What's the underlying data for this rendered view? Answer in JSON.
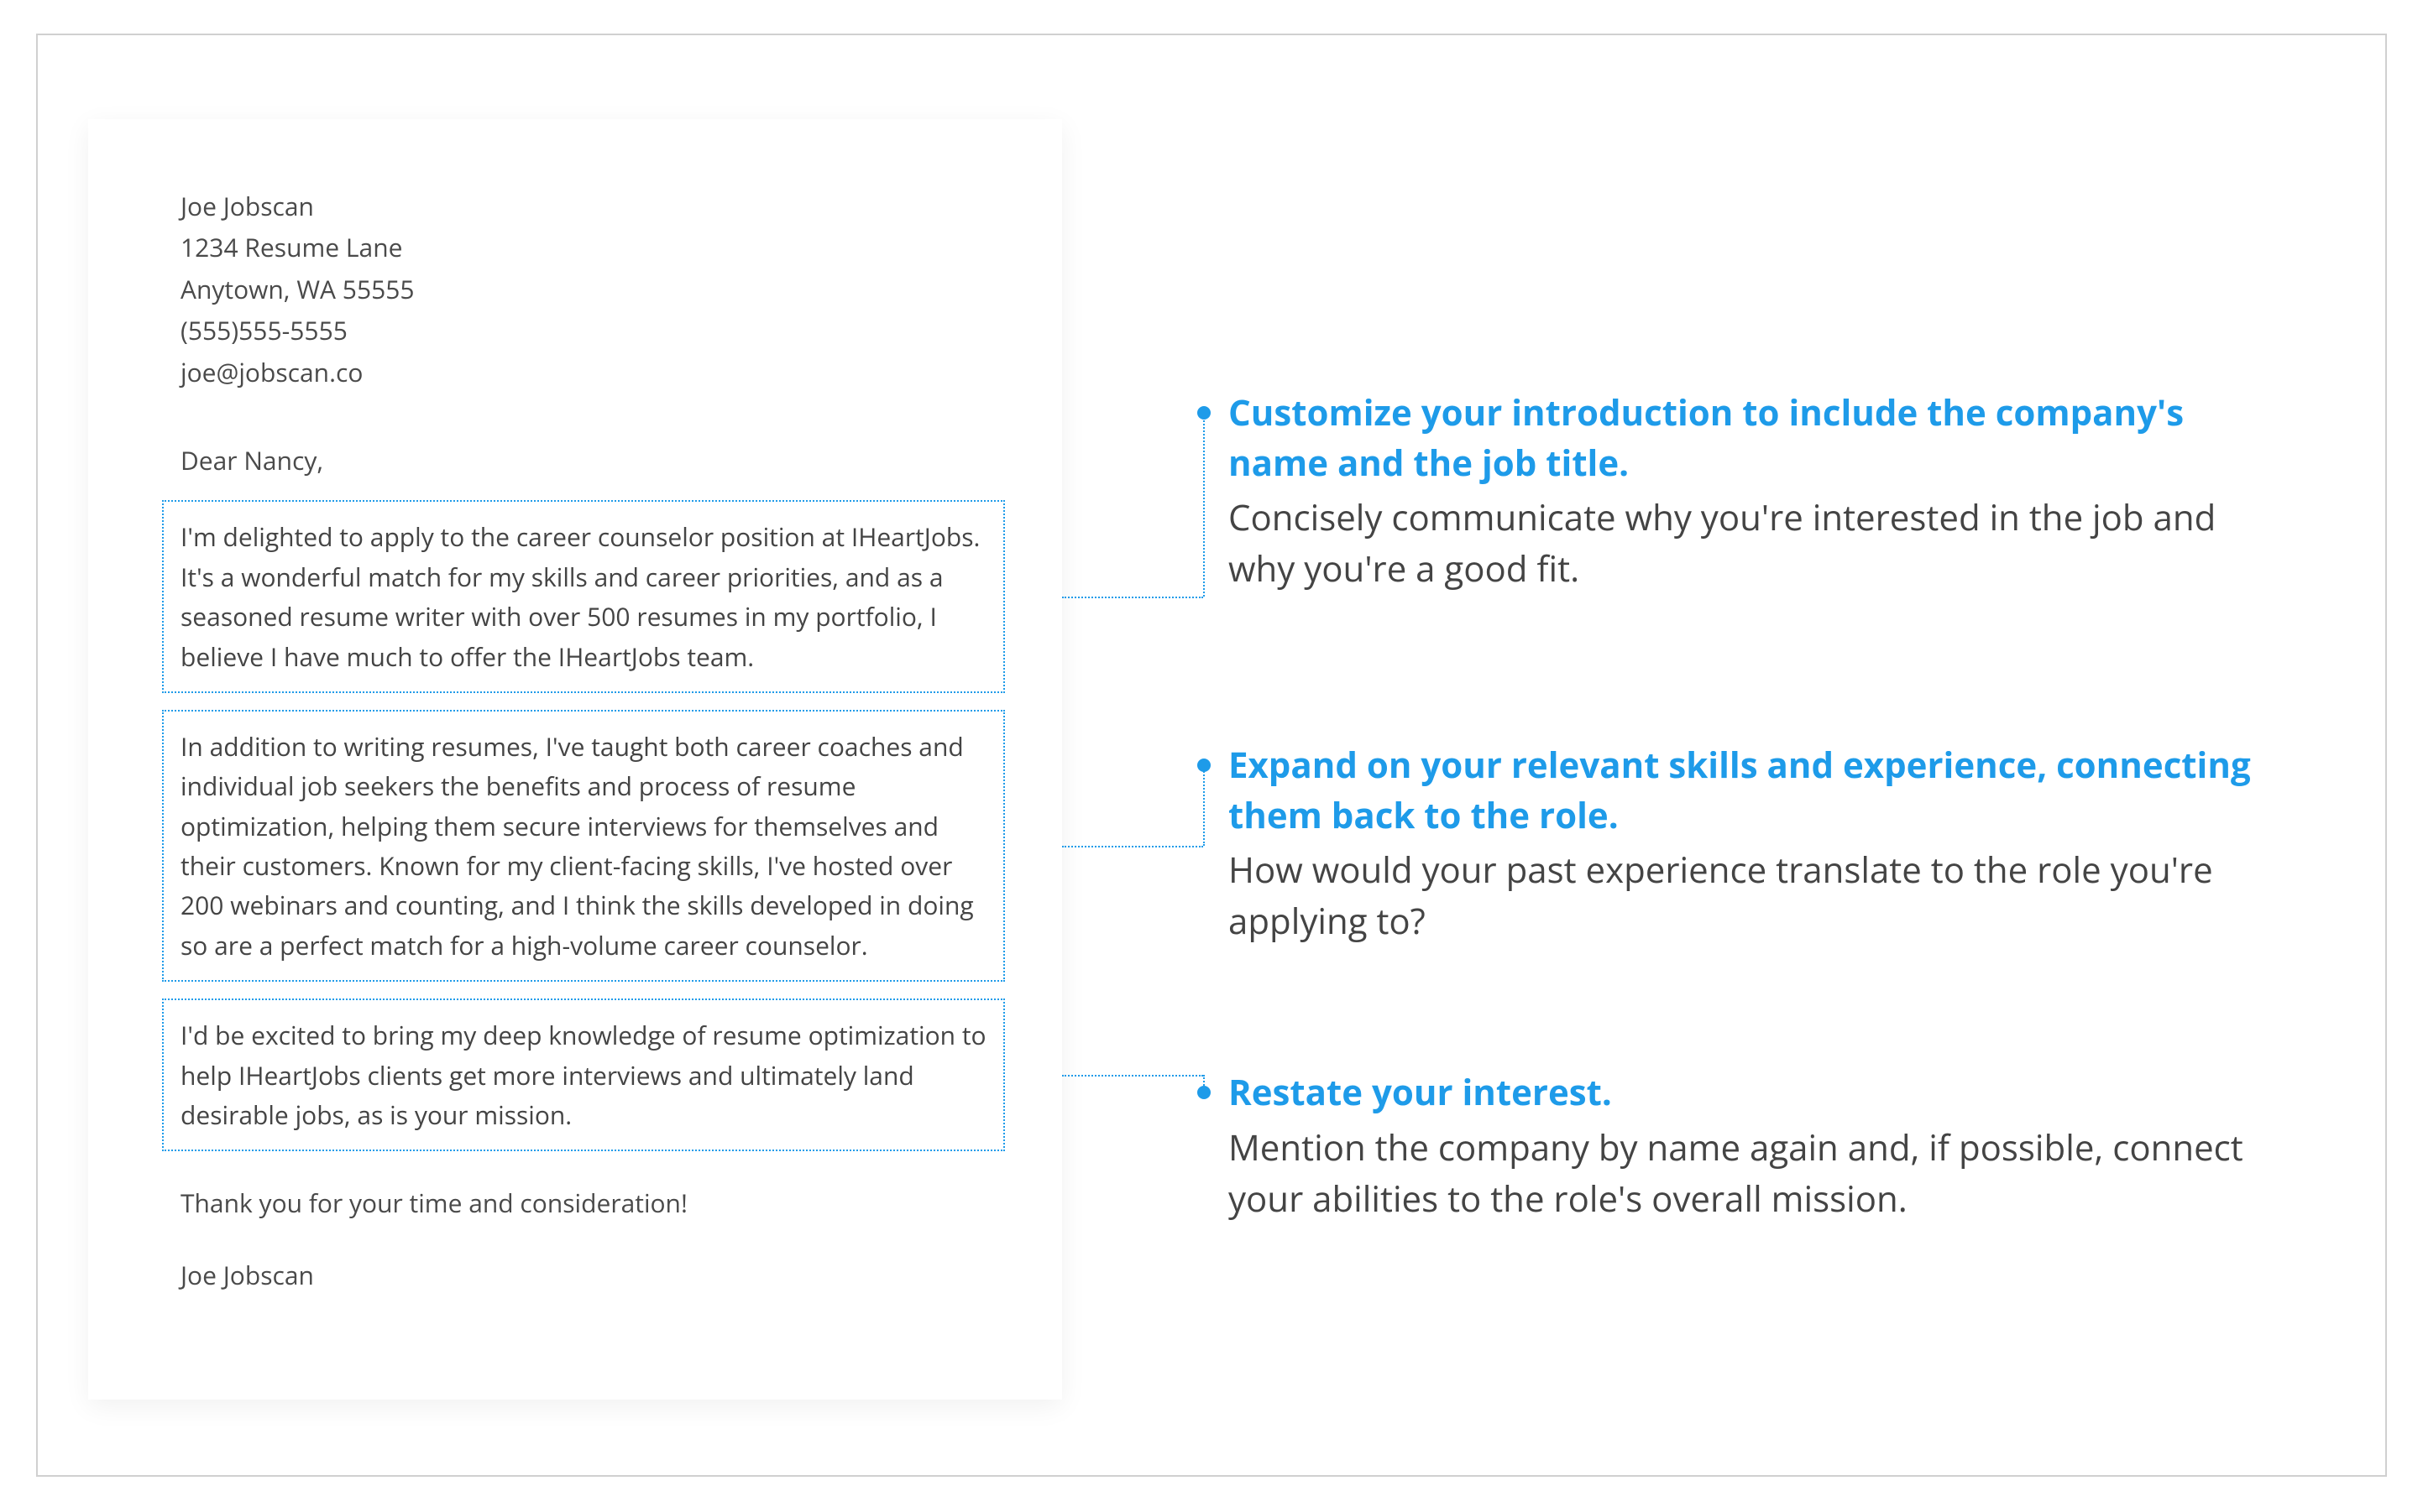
{
  "letter": {
    "name": "Joe Jobscan",
    "street": "1234 Resume Lane",
    "citystate": "Anytown, WA 55555",
    "phone": "(555)555-5555",
    "email": "joe@jobscan.co",
    "salutation": "Dear Nancy,",
    "p1": "I'm delighted to apply to the career counselor position at IHeartJobs. It's a wonderful match for my skills and career priorities, and as a seasoned resume writer with over 500 resumes in my portfolio, I believe I have much to offer the IHeartJobs team.",
    "p2": "In addition to writing resumes, I've taught both career coaches and individual job seekers the benefits and process of resume optimization, helping them secure interviews for themselves and their customers. Known for my client-facing skills, I've hosted over 200 webinars and counting, and I think the skills developed in doing so are a perfect match for a high-volume career counselor.",
    "p3": "I'd be excited to bring my deep knowledge of resume optimization to help IHeartJobs clients get more interviews and ultimately land desirable jobs, as is your mission.",
    "thanks": "Thank you for your time and consideration!",
    "signoff": "Joe Jobscan"
  },
  "annotations": [
    {
      "title": "Customize your introduction to include the company's name and the job title.",
      "body": "Concisely communicate why you're interested in the job and why you're a good fit."
    },
    {
      "title": "Expand on your relevant skills and experience, connecting them back to the role.",
      "body": "How would your past experience translate to the role you're applying to?"
    },
    {
      "title": "Restate your interest.",
      "body": "Mention the company by name again and, if possible, connect your abilities to the role's overall mission."
    }
  ]
}
